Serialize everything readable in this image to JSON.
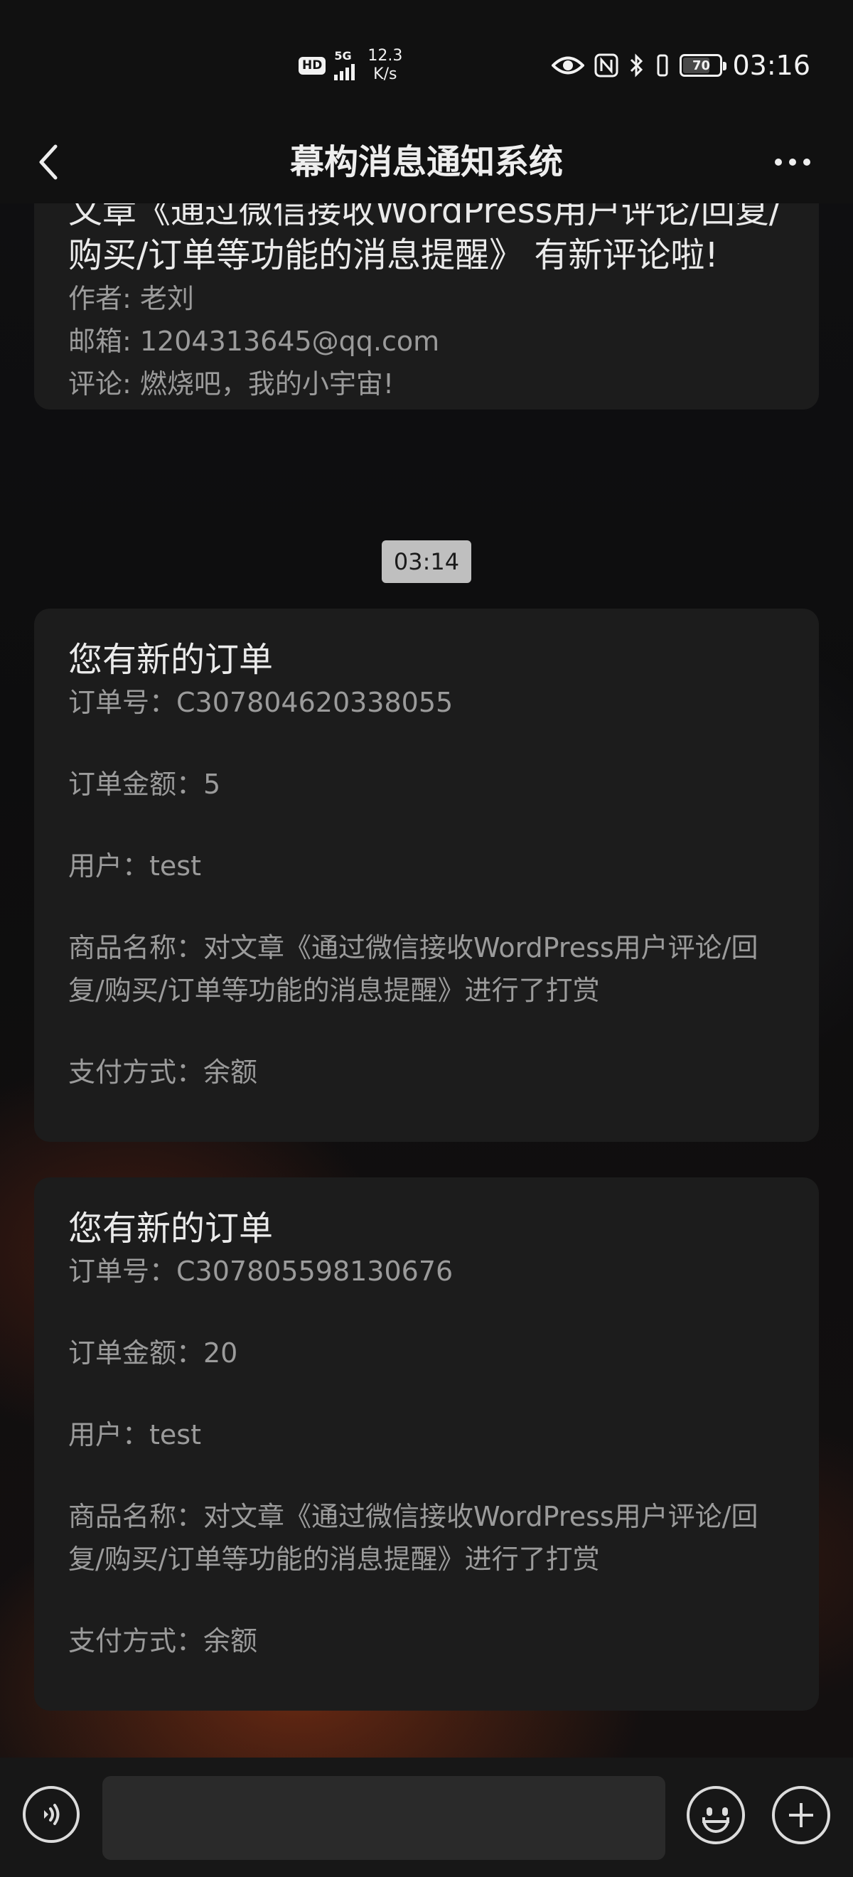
{
  "status_bar": {
    "hd_badge": "HD",
    "network": "5G",
    "speed_value": "12.3",
    "speed_unit": "K/s",
    "battery_level": "70",
    "time": "03:16"
  },
  "nav": {
    "title": "幕构消息通知系统",
    "back_icon": "chevron-left-icon",
    "more_icon": "more-dots-icon"
  },
  "messages": {
    "comment": {
      "title_partial": "文章《通过微信接收WordPress用户评论/回复/购买/订单等功能的消息提醒》 有新评论啦!",
      "author": "作者: 老刘",
      "email": "邮箱: 1204313645@qq.com",
      "comment": "评论: 燃烧吧，我的小宇宙!"
    },
    "timestamp": "03:14",
    "order1": {
      "title": "您有新的订单",
      "order_no": "订单号：C307804620338055",
      "amount": "订单金额：5",
      "user": "用户：test",
      "product": "商品名称：对文章《通过微信接收WordPress用户评论/回复/购买/订单等功能的消息提醒》进行了打赏",
      "payment": "支付方式：余额"
    },
    "order2": {
      "title": "您有新的订单",
      "order_no": "订单号：C307805598130676",
      "amount": "订单金额：20",
      "user": "用户：test",
      "product": "商品名称：对文章《通过微信接收WordPress用户评论/回复/购买/订单等功能的消息提醒》进行了打赏",
      "payment": "支付方式：余额"
    }
  },
  "input_bar": {
    "voice_icon": "voice-icon",
    "input_value": "",
    "emoji_icon": "emoji-icon",
    "plus_icon": "plus-icon"
  }
}
